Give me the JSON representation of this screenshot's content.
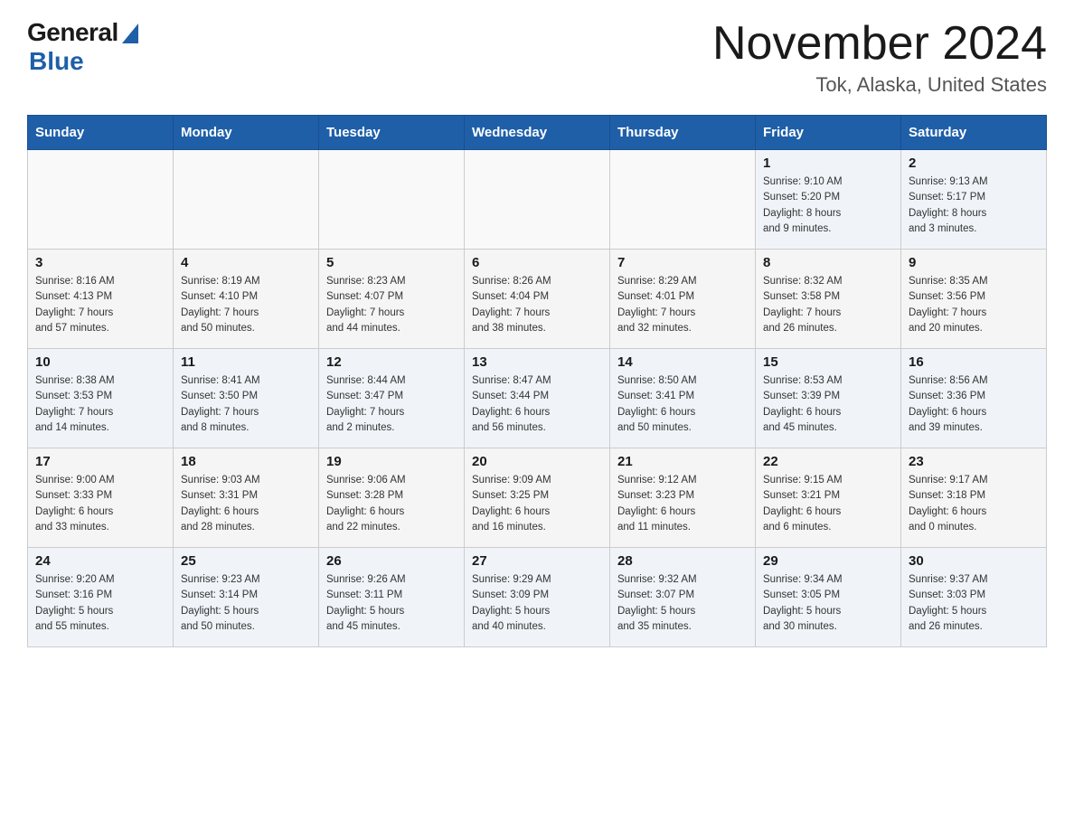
{
  "header": {
    "logo_general": "General",
    "logo_blue": "Blue",
    "month_title": "November 2024",
    "location": "Tok, Alaska, United States"
  },
  "days_of_week": [
    "Sunday",
    "Monday",
    "Tuesday",
    "Wednesday",
    "Thursday",
    "Friday",
    "Saturday"
  ],
  "weeks": [
    [
      {
        "day": "",
        "info": ""
      },
      {
        "day": "",
        "info": ""
      },
      {
        "day": "",
        "info": ""
      },
      {
        "day": "",
        "info": ""
      },
      {
        "day": "",
        "info": ""
      },
      {
        "day": "1",
        "info": "Sunrise: 9:10 AM\nSunset: 5:20 PM\nDaylight: 8 hours\nand 9 minutes."
      },
      {
        "day": "2",
        "info": "Sunrise: 9:13 AM\nSunset: 5:17 PM\nDaylight: 8 hours\nand 3 minutes."
      }
    ],
    [
      {
        "day": "3",
        "info": "Sunrise: 8:16 AM\nSunset: 4:13 PM\nDaylight: 7 hours\nand 57 minutes."
      },
      {
        "day": "4",
        "info": "Sunrise: 8:19 AM\nSunset: 4:10 PM\nDaylight: 7 hours\nand 50 minutes."
      },
      {
        "day": "5",
        "info": "Sunrise: 8:23 AM\nSunset: 4:07 PM\nDaylight: 7 hours\nand 44 minutes."
      },
      {
        "day": "6",
        "info": "Sunrise: 8:26 AM\nSunset: 4:04 PM\nDaylight: 7 hours\nand 38 minutes."
      },
      {
        "day": "7",
        "info": "Sunrise: 8:29 AM\nSunset: 4:01 PM\nDaylight: 7 hours\nand 32 minutes."
      },
      {
        "day": "8",
        "info": "Sunrise: 8:32 AM\nSunset: 3:58 PM\nDaylight: 7 hours\nand 26 minutes."
      },
      {
        "day": "9",
        "info": "Sunrise: 8:35 AM\nSunset: 3:56 PM\nDaylight: 7 hours\nand 20 minutes."
      }
    ],
    [
      {
        "day": "10",
        "info": "Sunrise: 8:38 AM\nSunset: 3:53 PM\nDaylight: 7 hours\nand 14 minutes."
      },
      {
        "day": "11",
        "info": "Sunrise: 8:41 AM\nSunset: 3:50 PM\nDaylight: 7 hours\nand 8 minutes."
      },
      {
        "day": "12",
        "info": "Sunrise: 8:44 AM\nSunset: 3:47 PM\nDaylight: 7 hours\nand 2 minutes."
      },
      {
        "day": "13",
        "info": "Sunrise: 8:47 AM\nSunset: 3:44 PM\nDaylight: 6 hours\nand 56 minutes."
      },
      {
        "day": "14",
        "info": "Sunrise: 8:50 AM\nSunset: 3:41 PM\nDaylight: 6 hours\nand 50 minutes."
      },
      {
        "day": "15",
        "info": "Sunrise: 8:53 AM\nSunset: 3:39 PM\nDaylight: 6 hours\nand 45 minutes."
      },
      {
        "day": "16",
        "info": "Sunrise: 8:56 AM\nSunset: 3:36 PM\nDaylight: 6 hours\nand 39 minutes."
      }
    ],
    [
      {
        "day": "17",
        "info": "Sunrise: 9:00 AM\nSunset: 3:33 PM\nDaylight: 6 hours\nand 33 minutes."
      },
      {
        "day": "18",
        "info": "Sunrise: 9:03 AM\nSunset: 3:31 PM\nDaylight: 6 hours\nand 28 minutes."
      },
      {
        "day": "19",
        "info": "Sunrise: 9:06 AM\nSunset: 3:28 PM\nDaylight: 6 hours\nand 22 minutes."
      },
      {
        "day": "20",
        "info": "Sunrise: 9:09 AM\nSunset: 3:25 PM\nDaylight: 6 hours\nand 16 minutes."
      },
      {
        "day": "21",
        "info": "Sunrise: 9:12 AM\nSunset: 3:23 PM\nDaylight: 6 hours\nand 11 minutes."
      },
      {
        "day": "22",
        "info": "Sunrise: 9:15 AM\nSunset: 3:21 PM\nDaylight: 6 hours\nand 6 minutes."
      },
      {
        "day": "23",
        "info": "Sunrise: 9:17 AM\nSunset: 3:18 PM\nDaylight: 6 hours\nand 0 minutes."
      }
    ],
    [
      {
        "day": "24",
        "info": "Sunrise: 9:20 AM\nSunset: 3:16 PM\nDaylight: 5 hours\nand 55 minutes."
      },
      {
        "day": "25",
        "info": "Sunrise: 9:23 AM\nSunset: 3:14 PM\nDaylight: 5 hours\nand 50 minutes."
      },
      {
        "day": "26",
        "info": "Sunrise: 9:26 AM\nSunset: 3:11 PM\nDaylight: 5 hours\nand 45 minutes."
      },
      {
        "day": "27",
        "info": "Sunrise: 9:29 AM\nSunset: 3:09 PM\nDaylight: 5 hours\nand 40 minutes."
      },
      {
        "day": "28",
        "info": "Sunrise: 9:32 AM\nSunset: 3:07 PM\nDaylight: 5 hours\nand 35 minutes."
      },
      {
        "day": "29",
        "info": "Sunrise: 9:34 AM\nSunset: 3:05 PM\nDaylight: 5 hours\nand 30 minutes."
      },
      {
        "day": "30",
        "info": "Sunrise: 9:37 AM\nSunset: 3:03 PM\nDaylight: 5 hours\nand 26 minutes."
      }
    ]
  ]
}
